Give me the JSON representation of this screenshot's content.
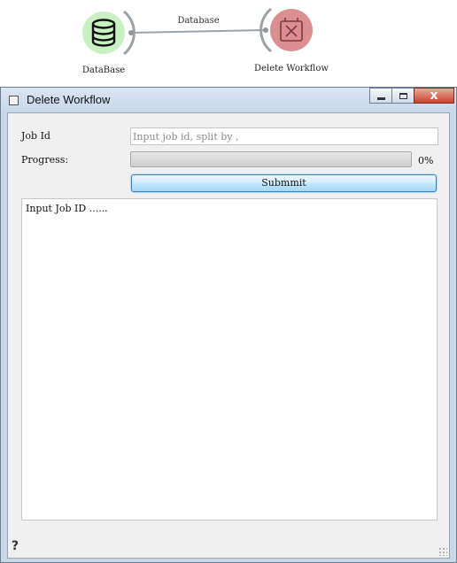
{
  "canvas": {
    "nodes": [
      {
        "id": "database",
        "label": "DataBase",
        "icon": "database-icon",
        "color": "#c9f0c2"
      },
      {
        "id": "delete-workflow",
        "label": "Delete Workflow",
        "icon": "delete-box-icon",
        "color": "#dc8f91"
      }
    ],
    "link_label": "Database"
  },
  "window": {
    "title": "Delete Workflow",
    "close_glyph": "x"
  },
  "form": {
    "jobid_label": "Job Id",
    "jobid_value": "",
    "jobid_placeholder": "Input job id, split by ,",
    "progress_label": "Progress:",
    "progress_value": 0,
    "progress_text": "0%",
    "submit_label": "Submmit"
  },
  "log": {
    "text": "Input Job ID ......"
  },
  "footer": {
    "help_glyph": "?"
  }
}
